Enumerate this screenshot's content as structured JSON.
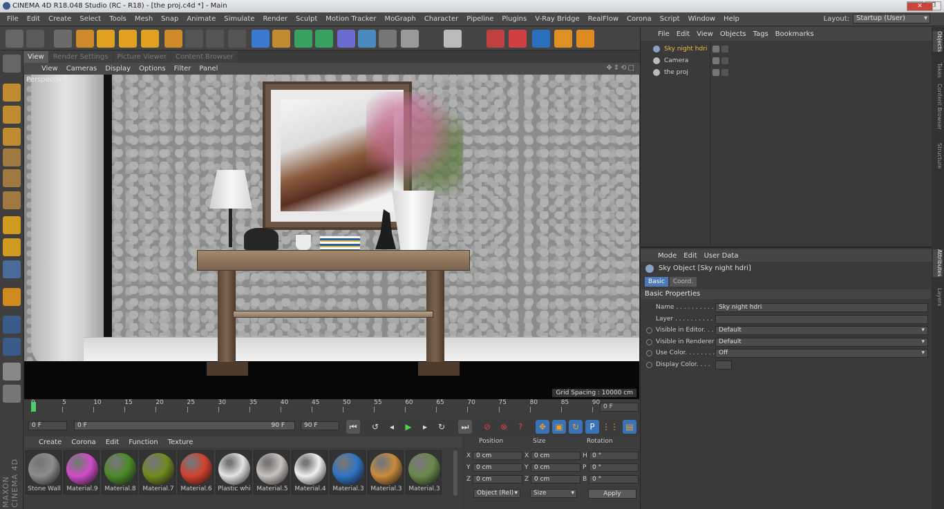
{
  "titlebar": {
    "title": "CINEMA 4D R18.048 Studio (RC - R18) - [the proj.c4d *] - Main",
    "buttons": [
      "–",
      "❐",
      "✕"
    ]
  },
  "menubar": {
    "items": [
      "File",
      "Edit",
      "Create",
      "Select",
      "Tools",
      "Mesh",
      "Snap",
      "Animate",
      "Simulate",
      "Render",
      "Sculpt",
      "Motion Tracker",
      "MoGraph",
      "Character",
      "Pipeline",
      "Plugins",
      "V-Ray Bridge",
      "RealFlow",
      "Corona",
      "Script",
      "Window",
      "Help"
    ],
    "layout_label": "Layout:",
    "layout_value": "Startup (User)"
  },
  "toolbar_icons": [
    "undo-icon",
    "redo-icon",
    "live-selection-icon",
    "move-icon",
    "scale-icon",
    "rotate-icon",
    "last-tool-icon",
    "coordinate-system-icon",
    "render-view-icon",
    "render-picture-viewer-icon",
    "edit-render-settings-icon",
    "cube-icon",
    "pen-icon",
    "subdivision-icon",
    "cloner-icon",
    "deformer-icon",
    "floor-icon",
    "camera-icon",
    "light-icon",
    "previous-icon",
    "document-icon",
    "next-icon",
    "vray-render-icon",
    "vray-stop-icon",
    "realflow-icon",
    "corona-icon",
    "script-icon"
  ],
  "viewport_tabs": [
    "View",
    "Render Settings",
    "Picture Viewer",
    "Content Browser"
  ],
  "viewport_menu": [
    "View",
    "Cameras",
    "Display",
    "Options",
    "Filter",
    "Panel"
  ],
  "viewport": {
    "label": "Perspective",
    "grid_spacing": "Grid Spacing : 10000 cm"
  },
  "timeline": {
    "ticks": [
      "0",
      "5",
      "10",
      "15",
      "20",
      "25",
      "30",
      "35",
      "40",
      "45",
      "50",
      "55",
      "60",
      "65",
      "70",
      "75",
      "80",
      "85",
      "90"
    ],
    "current_frame": "0 F"
  },
  "transport": {
    "start": "0 F",
    "slider_left": "0 F",
    "slider_right": "90 F",
    "end": "90 F"
  },
  "material_menu": [
    "Create",
    "Corona",
    "Edit",
    "Function",
    "Texture"
  ],
  "materials": [
    {
      "name": "Stone Wall",
      "color": "#8d8d8d"
    },
    {
      "name": "Material.9",
      "color": "#d04cc8"
    },
    {
      "name": "Material.8",
      "color": "#4c8a26"
    },
    {
      "name": "Material.7",
      "color": "#6f8a1f"
    },
    {
      "name": "Material.6",
      "color": "#d2412e"
    },
    {
      "name": "Plastic whi",
      "color": "#e4e4e4"
    },
    {
      "name": "Material.5",
      "color": "#c9c2c0"
    },
    {
      "name": "Material.4",
      "color": "#f0f0f0"
    },
    {
      "name": "Material.3",
      "color": "#2f74c4"
    },
    {
      "name": "Material.3",
      "color": "#c98a3c"
    },
    {
      "name": "Material.3",
      "color": "#6a8a4c"
    }
  ],
  "coords": {
    "headers": [
      "Position",
      "Size",
      "Rotation"
    ],
    "rows": [
      {
        "axis": "X",
        "pos": "0 cm",
        "size_axis": "X",
        "size": "0 cm",
        "rot_axis": "H",
        "rot": "0 °"
      },
      {
        "axis": "Y",
        "pos": "0 cm",
        "size_axis": "Y",
        "size": "0 cm",
        "rot_axis": "P",
        "rot": "0 °"
      },
      {
        "axis": "Z",
        "pos": "0 cm",
        "size_axis": "Z",
        "size": "0 cm",
        "rot_axis": "B",
        "rot": "0 °"
      }
    ],
    "mode": "Object (Rel)",
    "size_mode": "Size",
    "apply": "Apply"
  },
  "object_menu": [
    "File",
    "Edit",
    "View",
    "Objects",
    "Tags",
    "Bookmarks"
  ],
  "objects": [
    {
      "name": "Sky night hdri",
      "color": "#f0c040",
      "icon_color": "#8aa2c4"
    },
    {
      "name": "Camera",
      "color": "#d0d0d0",
      "icon_color": "#bbbbbb"
    },
    {
      "name": "the proj",
      "color": "#d0d0d0",
      "icon_color": "#bbbbbb"
    }
  ],
  "attr_menu": [
    "Mode",
    "Edit",
    "User Data"
  ],
  "attributes": {
    "title": "Sky Object [Sky night hdri]",
    "tabs": [
      "Basic",
      "Coord."
    ],
    "section": "Basic Properties",
    "rows": [
      {
        "label": "Name . . . . . . . . . . .",
        "value": "Sky night hdri",
        "radio": false,
        "dropdown": false
      },
      {
        "label": "Layer . . . . . . . . . . .",
        "value": "",
        "radio": false,
        "dropdown": false
      },
      {
        "label": "Visible in Editor. . .",
        "value": "Default",
        "radio": true,
        "dropdown": true
      },
      {
        "label": "Visible in Renderer",
        "value": "Default",
        "radio": true,
        "dropdown": true
      },
      {
        "label": "Use Color. . . . . . . .",
        "value": "Off",
        "radio": true,
        "dropdown": true
      },
      {
        "label": "Display Color. . . .",
        "value": "",
        "radio": true,
        "dropdown": false
      }
    ]
  },
  "side_tabs": [
    "Objects",
    "Takes",
    "Content Browser",
    "Structure",
    "Attributes",
    "Layers"
  ],
  "maxon": "MAXON CINEMA 4D"
}
